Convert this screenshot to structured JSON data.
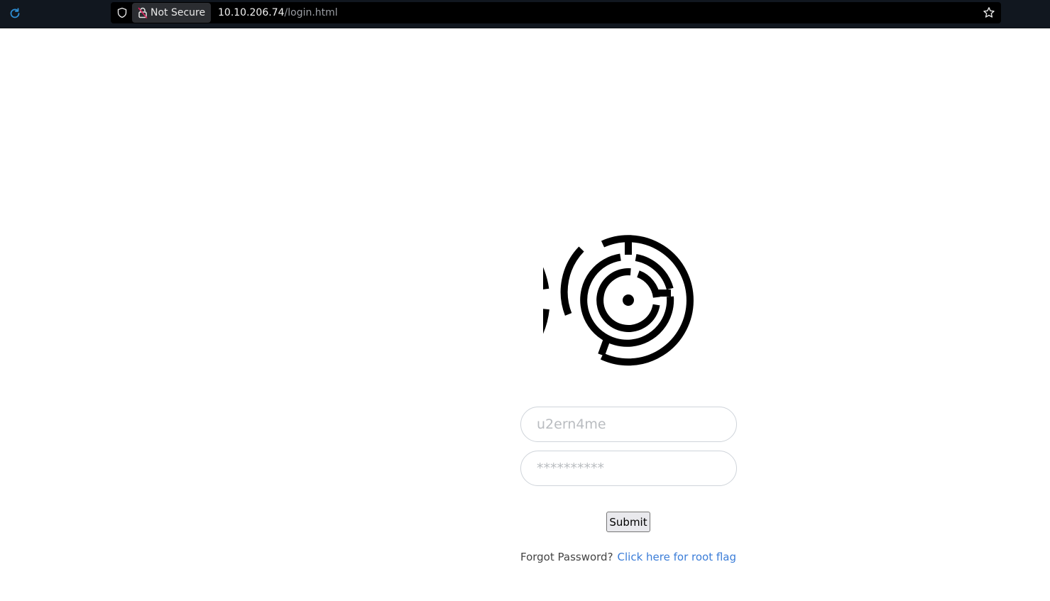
{
  "browser": {
    "security_label": "Not Secure",
    "url_host": "10.10.206.74",
    "url_path": "/login.html",
    "icons": [
      "reload-icon",
      "shield-icon",
      "broken-lock-icon",
      "bookmark-star-icon"
    ]
  },
  "login": {
    "logo": "maze-logo",
    "username_placeholder": "u2ern4me",
    "password_placeholder": "**********",
    "submit_label": "Submit",
    "forgot_text": "Forgot Password?",
    "forgot_link": "Click here for root flag"
  },
  "colors": {
    "topbar": "#11171f",
    "link": "#3b7dd8",
    "not_secure_lock": "#e0245e"
  }
}
